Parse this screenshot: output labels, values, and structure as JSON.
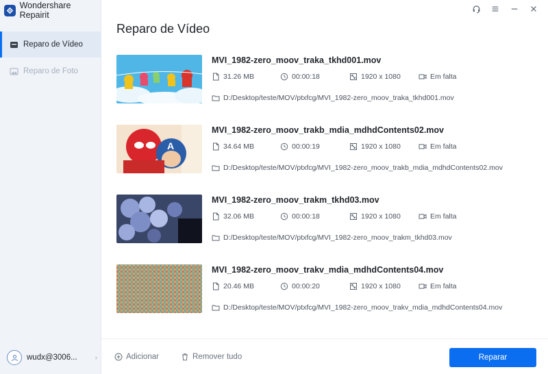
{
  "app": {
    "name": "Wondershare Repairit"
  },
  "sidebar": {
    "items": [
      {
        "label": "Reparo de Vídeo",
        "icon": "video-repair-icon",
        "active": true
      },
      {
        "label": "Reparo de Foto",
        "icon": "photo-repair-icon",
        "active": false
      }
    ],
    "account": {
      "name": "wudx@3006...",
      "icon": "user-icon"
    }
  },
  "window_controls": [
    "headset-support-icon",
    "menu-icon",
    "minimize-icon",
    "close-icon"
  ],
  "main": {
    "title": "Reparo de Vídeo",
    "files": [
      {
        "name": "MVI_1982-zero_moov_traka_tkhd001.mov",
        "size": "31.26  MB",
        "duration": "00:00:18",
        "resolution": "1920 x 1080",
        "status": "Em falta",
        "path": "D:/Desktop/teste/MOV/ptxfcg/MVI_1982-zero_moov_traka_tkhd001.mov"
      },
      {
        "name": "MVI_1982-zero_moov_trakb_mdia_mdhdContents02.mov",
        "size": "34.64  MB",
        "duration": "00:00:19",
        "resolution": "1920 x 1080",
        "status": "Em falta",
        "path": "D:/Desktop/teste/MOV/ptxfcg/MVI_1982-zero_moov_trakb_mdia_mdhdContents02.mov"
      },
      {
        "name": "MVI_1982-zero_moov_trakm_tkhd03.mov",
        "size": "32.06  MB",
        "duration": "00:00:18",
        "resolution": "1920 x 1080",
        "status": "Em falta",
        "path": "D:/Desktop/teste/MOV/ptxfcg/MVI_1982-zero_moov_trakm_tkhd03.mov"
      },
      {
        "name": "MVI_1982-zero_moov_trakv_mdia_mdhdContents04.mov",
        "size": "20.46  MB",
        "duration": "00:00:20",
        "resolution": "1920 x 1080",
        "status": "Em falta",
        "path": "D:/Desktop/teste/MOV/ptxfcg/MVI_1982-zero_moov_trakv_mdia_mdhdContents04.mov"
      }
    ]
  },
  "footer": {
    "add_label": "Adicionar",
    "remove_label": "Remover tudo",
    "repair_label": "Reparar"
  },
  "colors": {
    "accent": "#0b6ef0",
    "sidebar_bg": "#f0f4f9"
  }
}
